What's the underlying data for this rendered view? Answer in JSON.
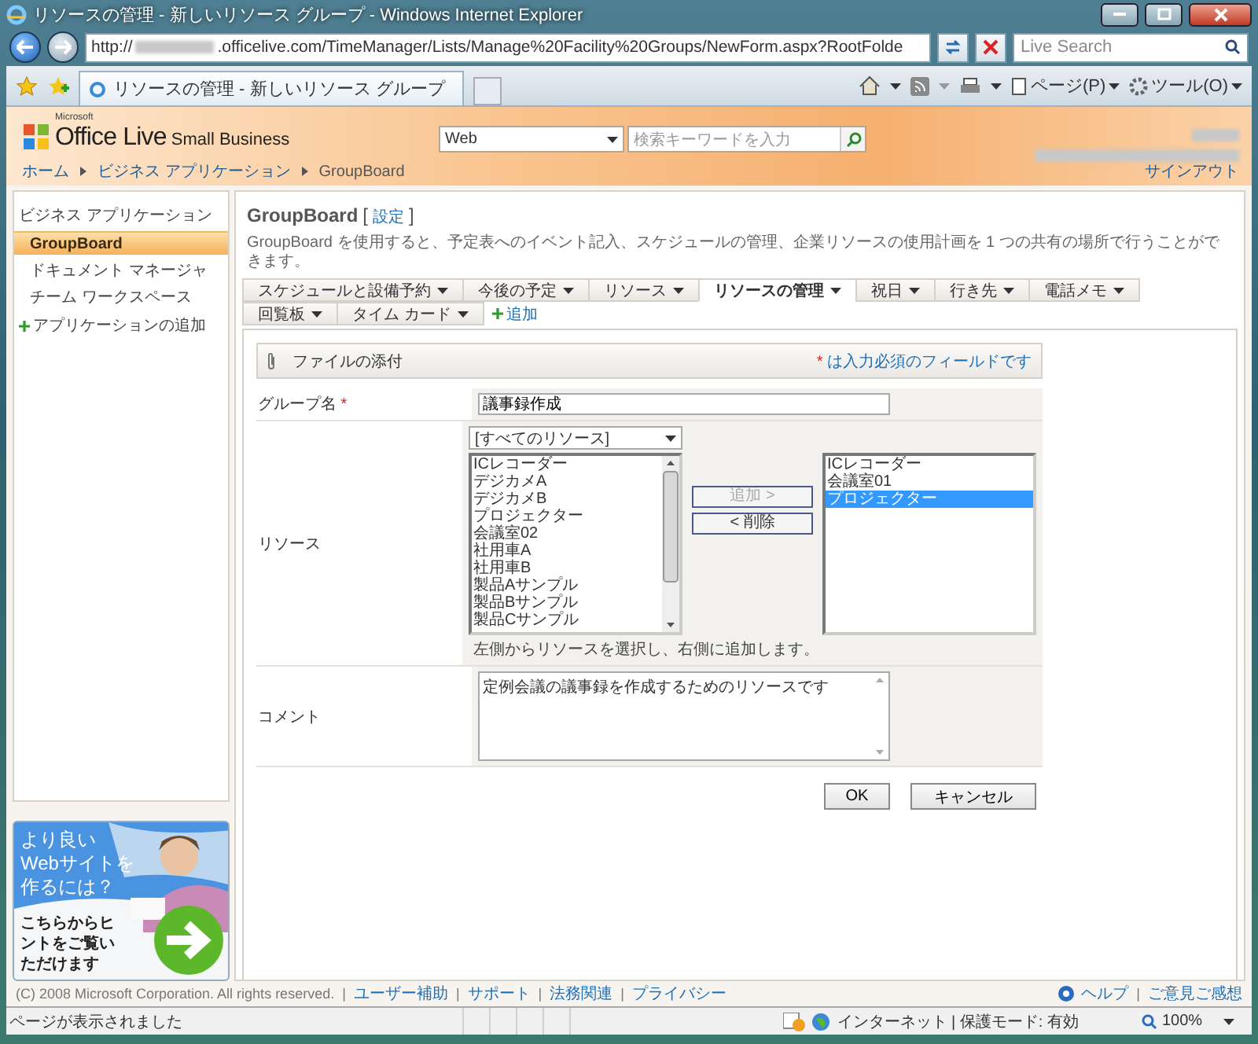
{
  "window": {
    "title": "リソースの管理 - 新しいリソース グループ - Windows Internet Explorer"
  },
  "browser": {
    "address_prefix": "http://",
    "address": ".officelive.com/TimeManager/Lists/Manage%20Facility%20Groups/NewForm.aspx?RootFolde",
    "search_placeholder": "Live Search",
    "tab_title": "リソースの管理 - 新しいリソース グループ",
    "page_menu": "ページ(P)",
    "tools_menu": "ツール(O)"
  },
  "site": {
    "brand_small": "Microsoft",
    "brand": "Office Live",
    "brand_sub": "Small Business",
    "search_scope": "Web",
    "search_placeholder": "検索キーワードを入力",
    "signout": "サインアウト",
    "breadcrumbs": [
      "ホーム",
      "ビジネス アプリケーション",
      "GroupBoard"
    ]
  },
  "sidebar": {
    "heading": "ビジネス アプリケーション",
    "items": [
      {
        "label": "GroupBoard",
        "selected": true
      },
      {
        "label": "ドキュメント マネージャ",
        "selected": false
      },
      {
        "label": "チーム ワークスペース",
        "selected": false
      }
    ],
    "add_label": "アプリケーションの追加"
  },
  "ad": {
    "kind": "picture",
    "headline_lines": [
      "より良い",
      "Webサイトを",
      "作るには？"
    ],
    "body_lines": [
      "こちらからヒ",
      "ントをご覧い",
      "ただけます"
    ]
  },
  "page": {
    "title": "GroupBoard",
    "brackets": [
      "[",
      "]"
    ],
    "settings_link": "設定",
    "description": "GroupBoard を使用すると、予定表へのイベント記入、スケジュールの管理、企業リソースの使用計画を 1 つの共有の場所で行うことができます。",
    "tabs": [
      {
        "label": "スケジュールと設備予約",
        "selected": false
      },
      {
        "label": "今後の予定",
        "selected": false
      },
      {
        "label": "リソース",
        "selected": false
      },
      {
        "label": "リソースの管理",
        "selected": true
      },
      {
        "label": "祝日",
        "selected": false
      },
      {
        "label": "行き先",
        "selected": false
      },
      {
        "label": "電話メモ",
        "selected": false
      },
      {
        "label": "回覧板",
        "selected": false
      },
      {
        "label": "タイム カード",
        "selected": false
      }
    ],
    "add_tab": "追加"
  },
  "form": {
    "attach": "ファイルの添付",
    "required_mark": "*",
    "required_note": "は入力必須のフィールドです",
    "group_name": {
      "label": "グループ名",
      "required": true,
      "value": "議事録作成"
    },
    "resources": {
      "label": "リソース",
      "filter": "[すべてのリソース]",
      "available": [
        "ICレコーダー",
        "デジカメA",
        "デジカメB",
        "プロジェクター",
        "会議室02",
        "社用車A",
        "社用車B",
        "製品Aサンプル",
        "製品Bサンプル",
        "製品Cサンプル"
      ],
      "add_button": {
        "label": "追加 >",
        "disabled": true
      },
      "remove_button": {
        "label": "< 削除",
        "disabled": false
      },
      "chosen": [
        {
          "label": "ICレコーダー",
          "selected": false
        },
        {
          "label": "会議室01",
          "selected": false
        },
        {
          "label": "プロジェクター",
          "selected": true
        }
      ],
      "hint": "左側からリソースを選択し、右側に追加します。"
    },
    "comment": {
      "label": "コメント",
      "value": "定例会議の議事録を作成するためのリソースです"
    },
    "buttons": [
      "OK",
      "キャンセル"
    ]
  },
  "footer": {
    "copyright": "(C) 2008 Microsoft Corporation. All rights reserved.",
    "separator": "|",
    "links": [
      "ユーザー補助",
      "サポート",
      "法務関連",
      "プライバシー"
    ],
    "help": "ヘルプ",
    "feedback": "ご意見ご感想"
  },
  "status": {
    "text": "ページが表示されました",
    "zone": "インターネット | 保護モード: 有効",
    "zoom": "100%"
  }
}
